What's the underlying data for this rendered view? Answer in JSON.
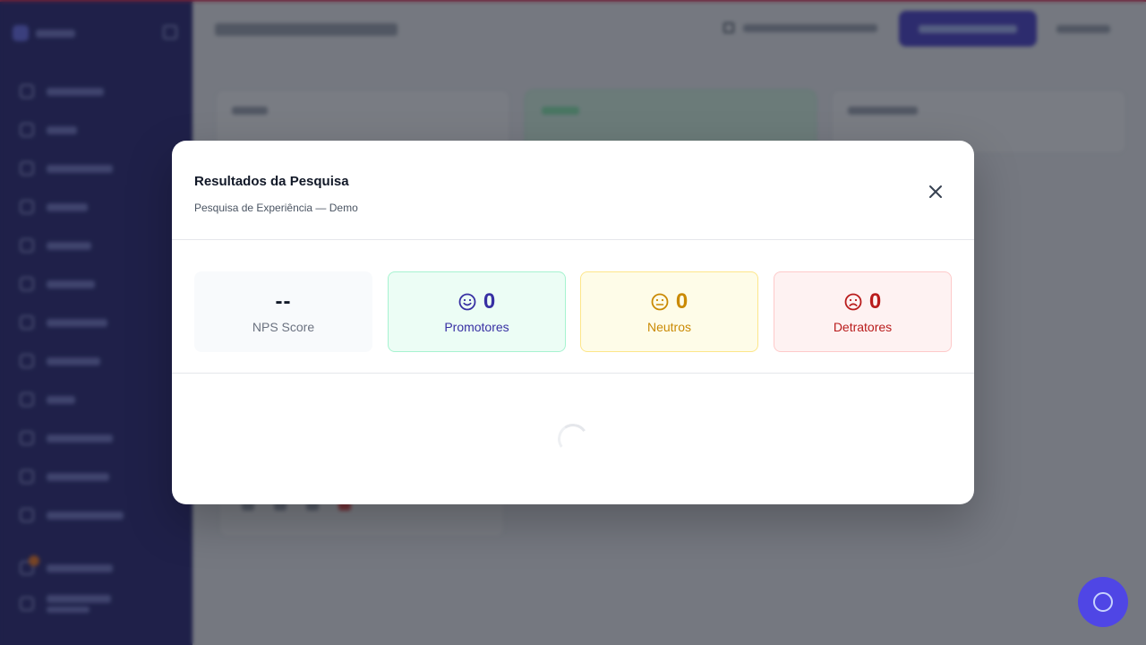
{
  "modal": {
    "title": "Resultados da Pesquisa",
    "subtitle": "Pesquisa de Experiência — Demo",
    "close_icon": "close-icon"
  },
  "metrics": {
    "nps": {
      "value": "--",
      "label": "NPS Score"
    },
    "promoters": {
      "value": "0",
      "label": "Promotores",
      "icon": "smile-icon",
      "color": "#3730a3"
    },
    "neutrals": {
      "value": "0",
      "label": "Neutros",
      "icon": "neutral-face-icon",
      "color": "#ca8a04"
    },
    "detractors": {
      "value": "0",
      "label": "Detratores",
      "icon": "frown-icon",
      "color": "#b91c1c"
    }
  },
  "loading": {
    "icon": "spinner-icon"
  },
  "colors": {
    "sidebar": "#1e1b6e",
    "primary": "#4338ca",
    "promoters_bg": "#ecfdf5",
    "neutrals_bg": "#fefce8",
    "detractors_bg": "#fef2f2"
  }
}
